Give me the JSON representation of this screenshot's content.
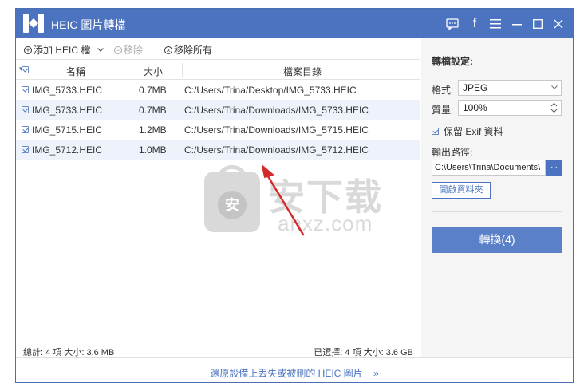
{
  "window": {
    "title": "HEIC 圖片轉檔"
  },
  "toolbar": {
    "add_label": "添加 HEIC 檔",
    "remove_label": "移除",
    "remove_all_label": "移除所有"
  },
  "table": {
    "headers": {
      "name": "名稱",
      "size": "大小",
      "path": "檔案目錄"
    },
    "rows": [
      {
        "name": "IMG_5733.HEIC",
        "size": "0.7MB",
        "path": "C:/Users/Trina/Desktop/IMG_5733.HEIC"
      },
      {
        "name": "IMG_5733.HEIC",
        "size": "0.7MB",
        "path": "C:/Users/Trina/Downloads/IMG_5733.HEIC"
      },
      {
        "name": "IMG_5715.HEIC",
        "size": "1.2MB",
        "path": "C:/Users/Trina/Downloads/IMG_5715.HEIC"
      },
      {
        "name": "IMG_5712.HEIC",
        "size": "1.0MB",
        "path": "C:/Users/Trina/Downloads/IMG_5712.HEIC"
      }
    ]
  },
  "status": {
    "total": "總計: 4 項 大小: 3.6 MB",
    "selected": "已選擇: 4 項 大小: 3.6 GB"
  },
  "footer": {
    "recover_link": "還原設備上丟失或被刪的 HEIC 圖片"
  },
  "settings": {
    "heading": "轉檔設定:",
    "format_label": "格式:",
    "format_value": "JPEG",
    "quality_label": "質量:",
    "quality_value": "100%",
    "keep_exif_label": "保留 Exif 資料",
    "output_label": "輸出路徑:",
    "output_value": "C:\\Users\\Trina\\Documents\\",
    "browse_label": "...",
    "open_folder_label": "開啟資料夾",
    "convert_label": "轉換(4)"
  },
  "watermark": {
    "main": "安下载",
    "sub": "anxz.com",
    "badge": "安"
  },
  "colors": {
    "accent": "#4c73c0",
    "row_alt": "#eef2fa",
    "panel_bg": "#f5f5f5",
    "arrow": "#d42a2a"
  }
}
